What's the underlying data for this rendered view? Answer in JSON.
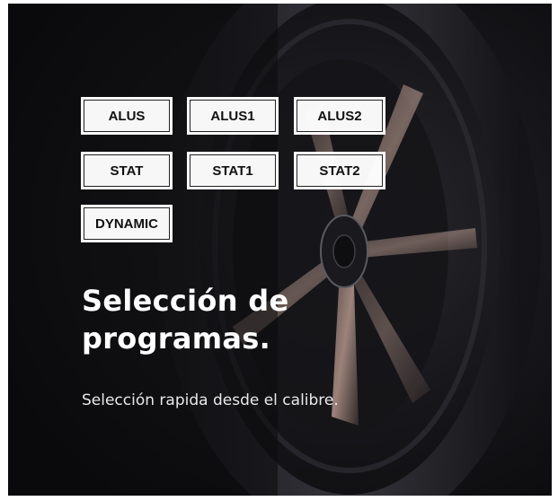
{
  "program_buttons": [
    {
      "label": "ALUS"
    },
    {
      "label": "ALUS1"
    },
    {
      "label": "ALUS2"
    },
    {
      "label": "STAT"
    },
    {
      "label": "STAT1"
    },
    {
      "label": "STAT2"
    },
    {
      "label": "DYNAMIC"
    }
  ],
  "hero": {
    "title": "Selección de programas.",
    "subtitle": "Selección rapida desde el calibre."
  },
  "background": {
    "subject": "car-wheel-photo",
    "base_color": "#0f0e10",
    "accent_color": "#c8a79a"
  }
}
